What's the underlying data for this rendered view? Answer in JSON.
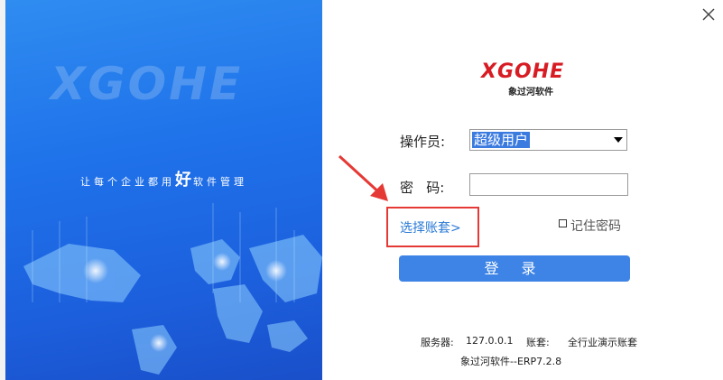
{
  "banner": {
    "logo_text": "XGOHE",
    "slogan_prefix": "让每个企业都用",
    "slogan_highlight": "好",
    "slogan_suffix": "软件管理"
  },
  "brand": {
    "logo_text": "XGOHE",
    "subtitle": "象过河软件",
    "accent_color": "#d71c24"
  },
  "form": {
    "operator_label": "操作员:",
    "operator_value": "超级用户",
    "password_label": "密  码:",
    "password_value": "",
    "select_account_link": "选择账套>",
    "remember_label": "记住密码",
    "remember_checked": false,
    "login_button": "登 录",
    "button_color": "#3d84e6"
  },
  "footer": {
    "server_label": "服务器:",
    "server_value": "127.0.0.1",
    "account_label": "账套:",
    "account_value": "全行业演示账套",
    "version": "象过河软件--ERP7.2.8"
  },
  "icons": {
    "close": "close-icon",
    "dropdown": "chevron-down-icon",
    "annotation_arrow": "arrow-icon"
  }
}
